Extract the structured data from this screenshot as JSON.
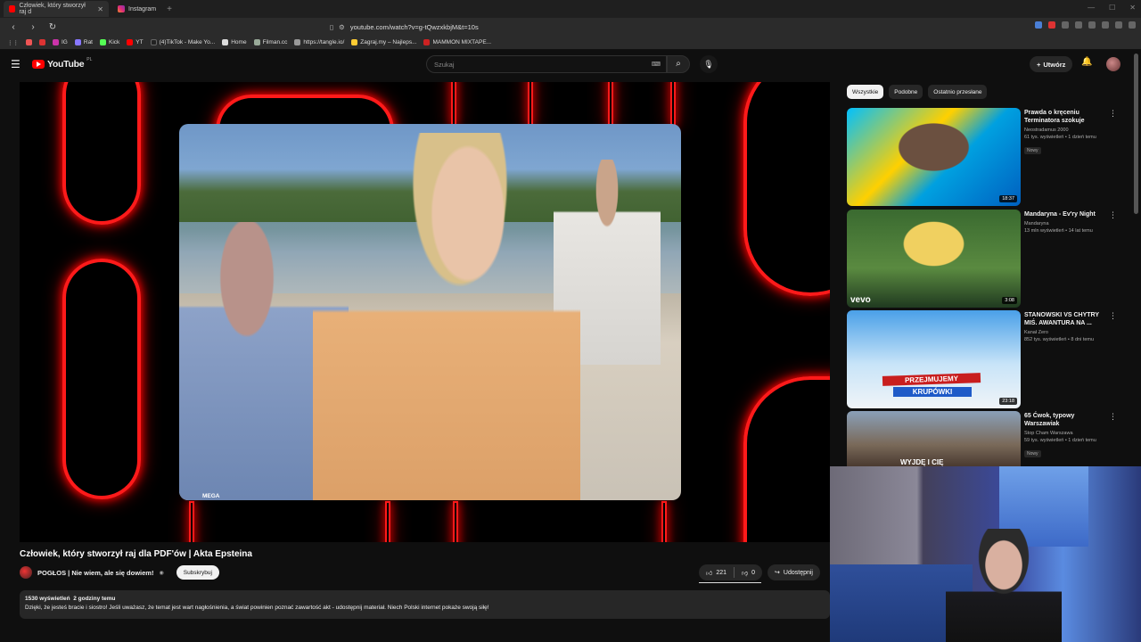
{
  "browser": {
    "tabs": [
      {
        "label": "Człowiek, który stworzył raj d",
        "active": true
      },
      {
        "label": "Instagram",
        "active": false
      }
    ],
    "url": "youtube.com/watch?v=g-tQwzxkbjM&t=10s",
    "bookmarks": [
      "IG",
      "Rat",
      "Kick",
      "YT",
      "(4)TikTok - Make Yo...",
      "Home",
      "Filman.cc",
      "https://tangle.io/",
      "Zagraj.my – Najleps...",
      "MAMMON MIXTAPE..."
    ]
  },
  "yt": {
    "logo": "YouTube",
    "country": "PL",
    "search_placeholder": "Szukaj",
    "create_label": "Utwórz"
  },
  "video": {
    "title": "Człowiek, który stworzył raj dla PDF'ów | Akta Epsteina",
    "channel": "POGŁOS | Nie wiem, ale się dowiem!",
    "subscribe": "Subskrybuj",
    "likes": "221",
    "dislikes": "0",
    "share": "Udostępnij",
    "views": "1530 wyświetleń",
    "age": "2 godziny temu",
    "description": "Dzięki, że jesteś bracie i siostro! Jeśli uważasz, że temat jest wart nagłośnienia, a świat powinien poznać zawartość akt - udostępnij materiał. Niech Polski internet pokaże swoją siłę!",
    "watermark": "MEGA"
  },
  "chips": [
    "Wszystkie",
    "Podobne",
    "Ostatnio przesłane"
  ],
  "recommendations": [
    {
      "title": "Prawda o kręceniu Terminatora szokuje",
      "channel": "Neostradamus 2000",
      "stats": "61 tys. wyświetleń • 1 dzień temu",
      "badge": "Nowy",
      "duration": "18:37"
    },
    {
      "title": "Mandaryna - Ev'ry Night",
      "channel": "Mandaryna",
      "stats": "13 mln wyświetleń • 14 lat temu",
      "badge": "",
      "duration": "3:08",
      "overlay": "vevo"
    },
    {
      "title": "STANOWSKI VS CHYTRY MIŚ. AWANTURA NA ...",
      "channel": "Kanał Zero",
      "stats": "852 tys. wyświetleń • 8 dni temu",
      "badge": "",
      "duration": "23:18",
      "overlay": "PRZEJMUJEMY KRUPÓWKI",
      "overlay1": "PRZEJMUJEMY",
      "overlay2": "KRUPÓWKI"
    },
    {
      "title": "65 Ćwok, typowy Warszawiak",
      "channel": "Stop Cham Warszawa",
      "stats": "59 tys. wyświetleń • 1 dzień temu",
      "badge": "Nowy",
      "duration": "",
      "overlay": "WYJDĘ I CIĘ"
    }
  ],
  "colors": {
    "brand": "#ff0000",
    "background": "#0f0f0f",
    "chip_bg": "#272727"
  }
}
